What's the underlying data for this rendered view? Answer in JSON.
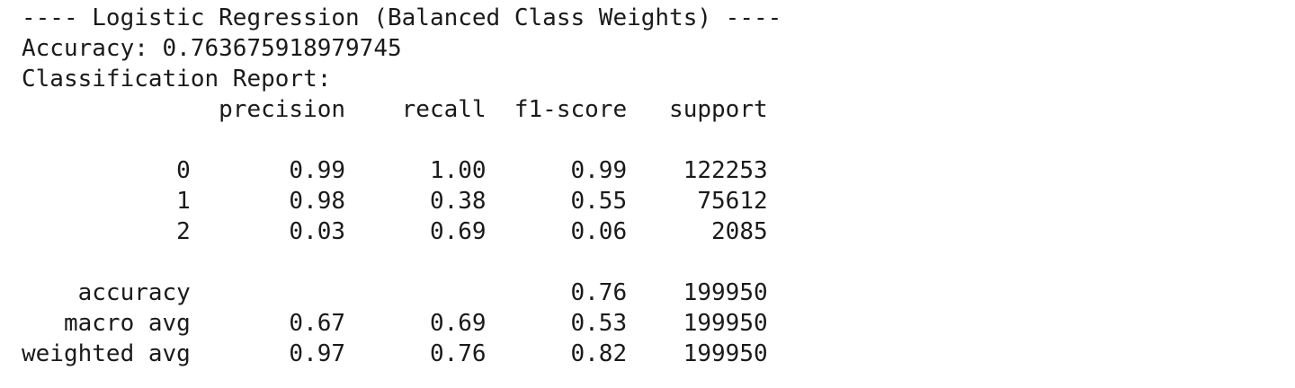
{
  "output": {
    "lines": [
      "---- Logistic Regression (Balanced Class Weights) ----",
      "Accuracy: 0.763675918979745",
      "Classification Report:",
      "              precision    recall  f1-score   support",
      "",
      "           0       0.99      1.00      0.99    122253",
      "           1       0.98      0.38      0.55     75612",
      "           2       0.03      0.69      0.06      2085",
      "",
      "    accuracy                           0.76    199950",
      "   macro avg       0.67      0.69      0.53    199950",
      "weighted avg       0.97      0.76      0.82    199950"
    ]
  }
}
